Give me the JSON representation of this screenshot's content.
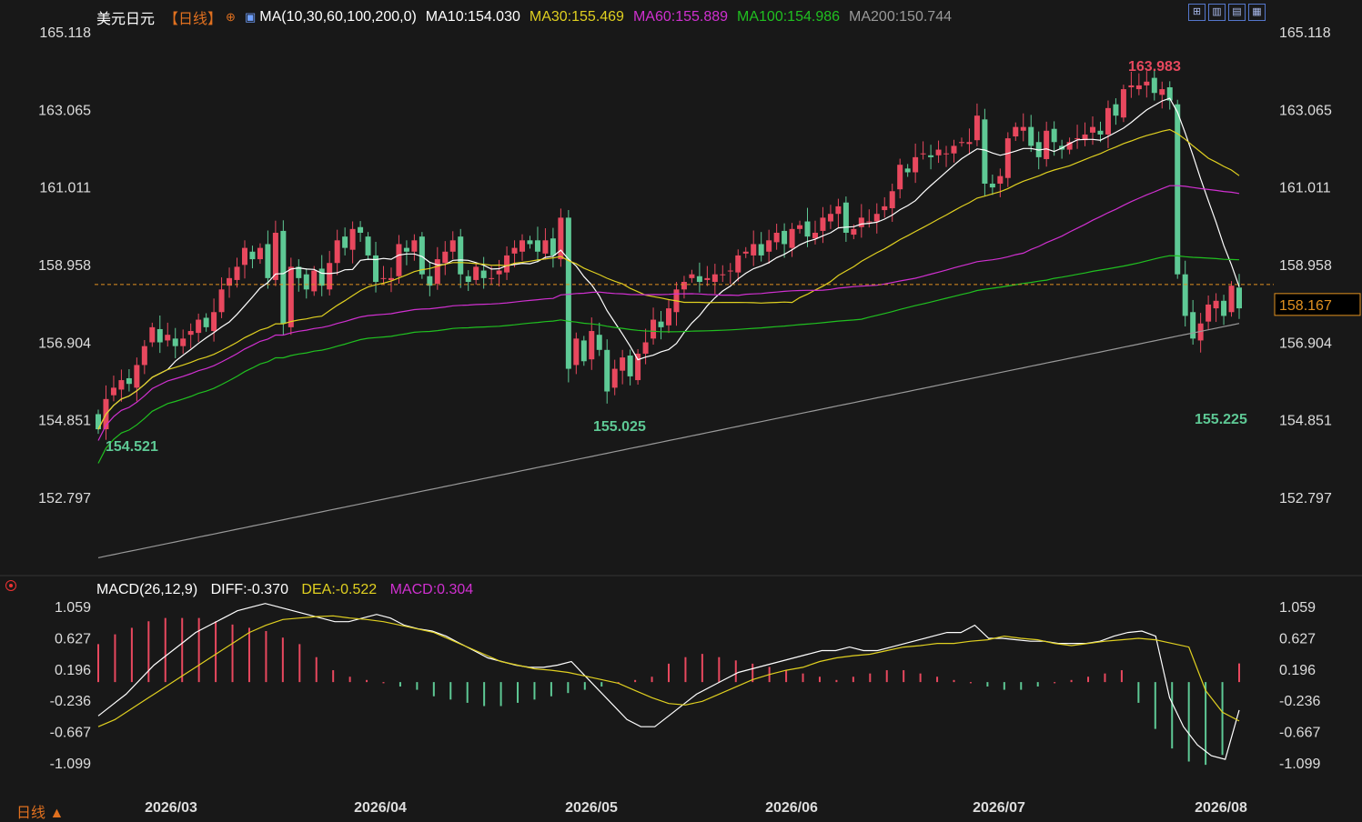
{
  "header": {
    "symbol": "美元日元",
    "period": "【日线】",
    "ma_params": "MA(10,30,60,100,200,0)",
    "ma10": "MA10:154.030",
    "ma30": "MA30:155.469",
    "ma60": "MA60:155.889",
    "ma100": "MA100:154.986",
    "ma200": "MA200:150.744"
  },
  "macd_header": {
    "params": "MACD(26,12,9)",
    "diff": "DIFF:-0.370",
    "dea": "DEA:-0.522",
    "macd": "MACD:0.304"
  },
  "footer": {
    "period_label": "日线 ▲"
  },
  "colors": {
    "up": "#e8485e",
    "down": "#5ec995",
    "ma10": "#ffffff",
    "ma30": "#e0d020",
    "ma60": "#d030d0",
    "ma100": "#20c020",
    "ma200": "#999999",
    "last_price": "#e09020"
  },
  "chart_data": [
    {
      "type": "candlestick",
      "title": "美元日元 日线",
      "y_ticks": [
        "165.118",
        "163.065",
        "161.011",
        "158.958",
        "156.904",
        "154.851",
        "152.797"
      ],
      "ylim": [
        151.5,
        165.5
      ],
      "x_ticks": [
        "2026/03",
        "2026/04",
        "2026/05",
        "2026/06",
        "2026/07",
        "2026/08"
      ],
      "last_price": "158.167",
      "annotations": {
        "high": "163.983",
        "low1": "154.521",
        "low2": "155.025",
        "low3": "155.225"
      },
      "close": [
        154.6,
        155.4,
        155.7,
        155.9,
        155.8,
        156.3,
        156.8,
        157.3,
        156.9,
        157.1,
        156.8,
        157.0,
        157.2,
        157.5,
        157.3,
        157.7,
        158.3,
        158.6,
        158.9,
        159.4,
        159.1,
        159.4,
        158.6,
        159.8,
        157.4,
        158.9,
        158.6,
        158.3,
        158.8,
        158.4,
        159.0,
        159.6,
        159.4,
        159.9,
        159.8,
        159.2,
        158.5,
        158.6,
        158.6,
        159.5,
        159.3,
        159.6,
        158.7,
        158.4,
        159.1,
        159.3,
        159.6,
        158.7,
        158.5,
        158.9,
        158.6,
        158.6,
        158.8,
        159.2,
        159.4,
        159.6,
        159.5,
        159.3,
        159.6,
        159.2,
        160.2,
        156.2,
        157.0,
        156.4,
        157.2,
        156.7,
        155.6,
        156.2,
        156.5,
        156.0,
        156.6,
        156.9,
        157.5,
        157.3,
        157.8,
        158.3,
        158.5,
        158.7,
        158.5,
        158.6,
        158.7,
        158.7,
        158.8,
        159.2,
        159.3,
        159.5,
        159.2,
        159.6,
        159.8,
        159.5,
        159.9,
        160.0,
        159.7,
        159.8,
        160.2,
        160.3,
        160.5,
        159.8,
        159.9,
        160.2,
        160.1,
        160.3,
        160.5,
        160.9,
        161.6,
        161.4,
        161.8,
        161.9,
        161.8,
        162.0,
        161.9,
        162.1,
        162.2,
        162.2,
        162.9,
        161.1,
        161.0,
        161.3,
        162.3,
        162.6,
        162.6,
        162.1,
        161.8,
        162.5,
        162.2,
        162.0,
        162.2,
        162.3,
        162.4,
        162.6,
        162.4,
        163.1,
        162.9,
        163.6,
        163.7,
        163.7,
        163.8,
        163.5,
        163.6,
        163.3,
        158.7,
        157.6,
        157.0,
        157.4,
        157.9,
        158.0,
        157.6,
        158.4,
        157.8
      ],
      "ma": {
        "MA10": "white",
        "MA30": "yellow",
        "MA60": "magenta",
        "MA100": "green",
        "MA200": "gray"
      }
    },
    {
      "type": "bar",
      "title": "MACD(26,12,9)",
      "y_ticks": [
        "1.059",
        "0.627",
        "0.196",
        "-0.236",
        "-0.667",
        "-1.099"
      ],
      "ylim": [
        -1.4,
        1.3
      ],
      "series": [
        {
          "name": "DIFF",
          "values": [
            -0.45,
            -0.3,
            -0.15,
            0.05,
            0.25,
            0.4,
            0.55,
            0.7,
            0.8,
            0.9,
            1.0,
            1.05,
            1.1,
            1.05,
            1.0,
            0.95,
            0.9,
            0.85,
            0.85,
            0.9,
            0.95,
            0.9,
            0.8,
            0.75,
            0.72,
            0.65,
            0.55,
            0.45,
            0.35,
            0.3,
            0.25,
            0.22,
            0.22,
            0.25,
            0.3,
            0.1,
            -0.1,
            -0.3,
            -0.5,
            -0.6,
            -0.6,
            -0.45,
            -0.3,
            -0.15,
            -0.05,
            0.05,
            0.15,
            0.2,
            0.25,
            0.3,
            0.35,
            0.4,
            0.45,
            0.45,
            0.5,
            0.45,
            0.45,
            0.5,
            0.55,
            0.6,
            0.65,
            0.7,
            0.7,
            0.8,
            0.62,
            0.62,
            0.6,
            0.58,
            0.58,
            0.55,
            0.55,
            0.55,
            0.58,
            0.65,
            0.7,
            0.72,
            0.65,
            -0.2,
            -0.6,
            -0.85,
            -1.0,
            -1.05,
            -0.37
          ]
        },
        {
          "name": "DEA",
          "values": [
            -0.6,
            -0.5,
            -0.35,
            -0.2,
            -0.05,
            0.1,
            0.25,
            0.4,
            0.55,
            0.7,
            0.8,
            0.88,
            0.9,
            0.92,
            0.93,
            0.9,
            0.88,
            0.85,
            0.8,
            0.75,
            0.7,
            0.6,
            0.5,
            0.4,
            0.3,
            0.25,
            0.2,
            0.18,
            0.15,
            0.1,
            0.05,
            0.0,
            -0.1,
            -0.2,
            -0.28,
            -0.3,
            -0.25,
            -0.15,
            -0.05,
            0.05,
            0.12,
            0.18,
            0.22,
            0.3,
            0.35,
            0.38,
            0.4,
            0.45,
            0.5,
            0.52,
            0.55,
            0.55,
            0.58,
            0.6,
            0.65,
            0.62,
            0.6,
            0.55,
            0.52,
            0.55,
            0.58,
            0.6,
            0.62,
            0.6,
            0.55,
            0.5,
            -0.1,
            -0.4,
            -0.52
          ]
        },
        {
          "name": "MACD",
          "values": [
            0.6,
            0.75,
            0.85,
            0.95,
            1.0,
            1.0,
            1.0,
            0.95,
            0.9,
            0.85,
            0.8,
            0.7,
            0.6,
            0.4,
            0.2,
            0.1,
            0.05,
            0.0,
            -0.05,
            -0.1,
            -0.2,
            -0.25,
            -0.3,
            -0.35,
            -0.35,
            -0.3,
            -0.25,
            -0.2,
            -0.15,
            -0.1,
            -0.05,
            0.0,
            0.05,
            0.1,
            0.3,
            0.4,
            0.45,
            0.4,
            0.35,
            0.3,
            0.25,
            0.2,
            0.15,
            0.1,
            0.05,
            0.1,
            0.15,
            0.2,
            0.2,
            0.15,
            0.1,
            0.05,
            0.0,
            -0.05,
            -0.1,
            -0.1,
            -0.05,
            0.0,
            0.05,
            0.1,
            0.15,
            0.2,
            -0.3,
            -0.7,
            -1.0,
            -1.2,
            -1.25,
            -1.1,
            0.304
          ]
        }
      ],
      "x_ticks": [
        "2026/03",
        "2026/04",
        "2026/05",
        "2026/06",
        "2026/07",
        "2026/08"
      ]
    }
  ]
}
